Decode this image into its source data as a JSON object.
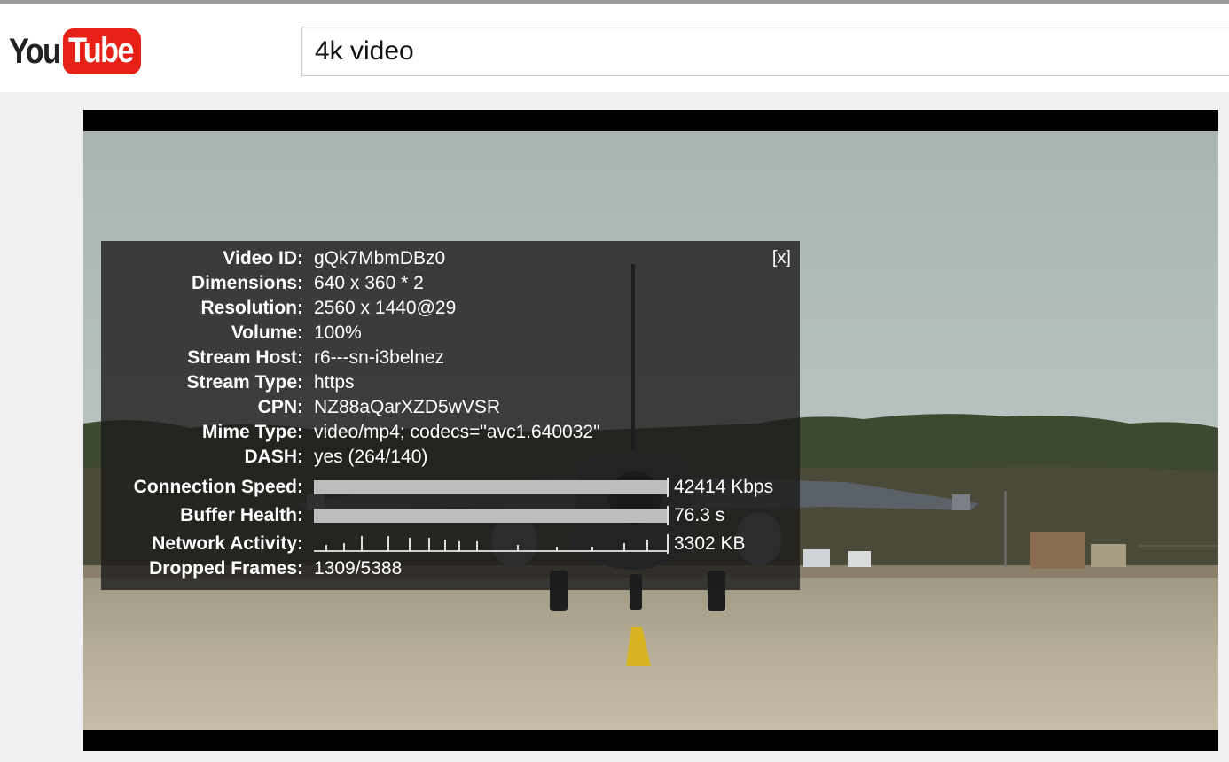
{
  "header": {
    "logo": {
      "you": "You",
      "tube": "Tube"
    },
    "search": {
      "value": "4k video"
    }
  },
  "stats": {
    "close_label": "[x]",
    "rows": [
      {
        "label": "Video ID:",
        "value": "gQk7MbmDBz0"
      },
      {
        "label": "Dimensions:",
        "value": "640 x 360 * 2"
      },
      {
        "label": "Resolution:",
        "value": "2560 x 1440@29"
      },
      {
        "label": "Volume:",
        "value": "100%"
      },
      {
        "label": "Stream Host:",
        "value": "r6---sn-i3belnez"
      },
      {
        "label": "Stream Type:",
        "value": "https"
      },
      {
        "label": "CPN:",
        "value": "NZ88aQarXZD5wVSR"
      },
      {
        "label": "Mime Type:",
        "value": "video/mp4; codecs=\"avc1.640032\""
      },
      {
        "label": "DASH:",
        "value": "yes (264/140)"
      }
    ],
    "connection_speed": {
      "label": "Connection Speed:",
      "value": "42414 Kbps",
      "fill": 1.0
    },
    "buffer_health": {
      "label": "Buffer Health:",
      "value": "76.3 s",
      "fill": 1.0
    },
    "network_activity": {
      "label": "Network Activity:",
      "value": "3302 KB"
    },
    "dropped_frames": {
      "label": "Dropped Frames:",
      "value": "1309/5388"
    }
  },
  "colors": {
    "brand_red": "#e62117",
    "overlay": "#1c1c1c"
  }
}
